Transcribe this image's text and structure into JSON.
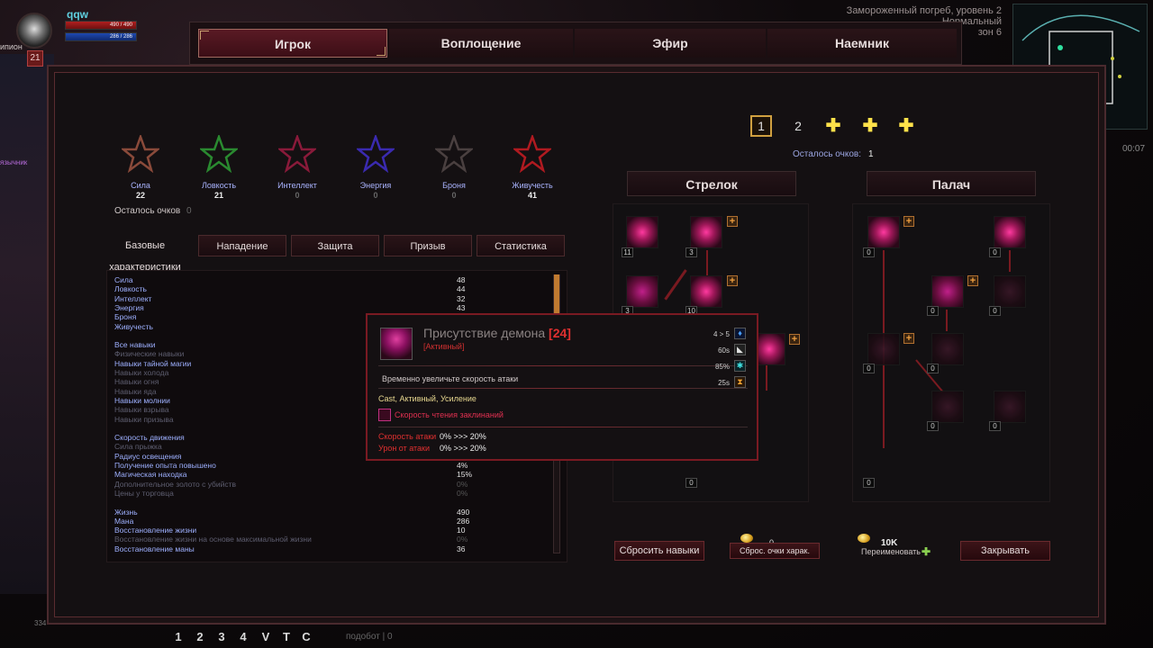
{
  "player": {
    "name": "qqw",
    "level": "21",
    "hp_text": "490 / 490",
    "mp_text": "286 / 286",
    "side_text": "ипион",
    "side_text2": "язычник"
  },
  "zone": {
    "line1": "Замороженный погреб, уровень 2",
    "line2": "Нормальный",
    "line3": "зон 6",
    "timer": "00:07"
  },
  "tabs": [
    {
      "label": "Игрок",
      "active": true
    },
    {
      "label": "Воплощение",
      "active": false
    },
    {
      "label": "Эфир",
      "active": false
    },
    {
      "label": "Наемник",
      "active": false
    }
  ],
  "attributes": [
    {
      "label": "Сила",
      "value": "22",
      "color": "#8a4a3a"
    },
    {
      "label": "Ловкость",
      "value": "21",
      "color": "#2a8a30"
    },
    {
      "label": "Интеллект",
      "value": "0",
      "color": "#8a1a3a"
    },
    {
      "label": "Энергия",
      "value": "0",
      "color": "#3a2ab0"
    },
    {
      "label": "Броня",
      "value": "0",
      "color": "#4a4040"
    },
    {
      "label": "Живучесть",
      "value": "41",
      "color": "#b01a20"
    }
  ],
  "attr_points": {
    "label": "Осталось очков",
    "value": "0"
  },
  "subtabs": [
    "Базовые характеристики",
    "Нападение",
    "Защита",
    "Призыв",
    "Статистика"
  ],
  "stats": [
    {
      "name": "Сила",
      "value": "48",
      "dim": false
    },
    {
      "name": "Ловкость",
      "value": "44",
      "dim": false
    },
    {
      "name": "Интеллект",
      "value": "32",
      "dim": false
    },
    {
      "name": "Энергия",
      "value": "43",
      "dim": false
    },
    {
      "name": "Броня",
      "value": "",
      "dim": false
    },
    {
      "name": "Живучесть",
      "value": "",
      "dim": false
    },
    {
      "name": "",
      "value": "",
      "dim": false
    },
    {
      "name": "Все навыки",
      "value": "",
      "dim": false
    },
    {
      "name": "Физические навыки",
      "value": "",
      "dim": true
    },
    {
      "name": "Навыки тайной магии",
      "value": "",
      "dim": false
    },
    {
      "name": "Навыки холода",
      "value": "",
      "dim": true
    },
    {
      "name": "Навыки огня",
      "value": "",
      "dim": true
    },
    {
      "name": "Навыки яда",
      "value": "",
      "dim": true
    },
    {
      "name": "Навыки молнии",
      "value": "",
      "dim": false
    },
    {
      "name": "Навыки взрыва",
      "value": "",
      "dim": true
    },
    {
      "name": "Навыки призыва",
      "value": "",
      "dim": true
    },
    {
      "name": "",
      "value": "",
      "dim": false
    },
    {
      "name": "Скорость движения",
      "value": "",
      "dim": false
    },
    {
      "name": "Сила прыжка",
      "value": "",
      "dim": true
    },
    {
      "name": "Радиус освещения",
      "value": "",
      "dim": false
    },
    {
      "name": "Получение опыта повышено",
      "value": "4%",
      "dim": false
    },
    {
      "name": "Магическая находка",
      "value": "15%",
      "dim": false
    },
    {
      "name": "Дополнительное золото с убийств",
      "value": "0%",
      "dim": true
    },
    {
      "name": "Цены у торговца",
      "value": "0%",
      "dim": true
    },
    {
      "name": "",
      "value": "",
      "dim": false
    },
    {
      "name": "Жизнь",
      "value": "490",
      "dim": false
    },
    {
      "name": "Мана",
      "value": "286",
      "dim": false
    },
    {
      "name": "Восстановление жизни",
      "value": "10",
      "dim": false
    },
    {
      "name": "Восстановление жизни на основе максимальной жизни",
      "value": "0%",
      "dim": true
    },
    {
      "name": "Восстановление маны",
      "value": "36",
      "dim": false
    }
  ],
  "skill_pages": {
    "pages": [
      "1",
      "2"
    ],
    "add_symbol": "✚",
    "points_label": "Осталось очков:",
    "points_value": "1"
  },
  "trees": [
    {
      "name": "Стрелок"
    },
    {
      "name": "Палач"
    }
  ],
  "skill_levels_left": [
    "11",
    "3",
    "3",
    "10",
    "0"
  ],
  "skill_levels_right": [
    "0",
    "0",
    "0",
    "0",
    "0",
    "0",
    "0",
    "0",
    "0"
  ],
  "tooltip": {
    "title": "Присутствие демона",
    "level": "[24]",
    "type": "[Активный]",
    "description": "Временно увеличьте скорость атаки",
    "tags": "Cast, Активный, Усиление",
    "effect": "Скорость чтения заклинаний",
    "stats": [
      {
        "name": "Скорость атаки",
        "value": "0% >>> 20%"
      },
      {
        "name": "Урон от атаки",
        "value": "0% >>> 20%"
      }
    ],
    "right": [
      {
        "text": "4 > 5",
        "icon": "mana-icon"
      },
      {
        "text": "60s",
        "icon": "cooldown-icon"
      },
      {
        "text": "85%",
        "icon": "cast-icon"
      },
      {
        "text": "25s",
        "icon": "duration-icon"
      }
    ]
  },
  "buttons": {
    "reset_skills": "Сбросить навыки",
    "reset_attrs": "Сброс. очки харак.",
    "reset_count": "0",
    "rename_cost": "10K",
    "rename": "Переименовать",
    "close": "Закрывать"
  },
  "hotbar": {
    "keys": [
      "1",
      "2",
      "3",
      "4",
      "V",
      "T",
      "C"
    ],
    "text": "подобот | 0",
    "side_num": "334"
  }
}
